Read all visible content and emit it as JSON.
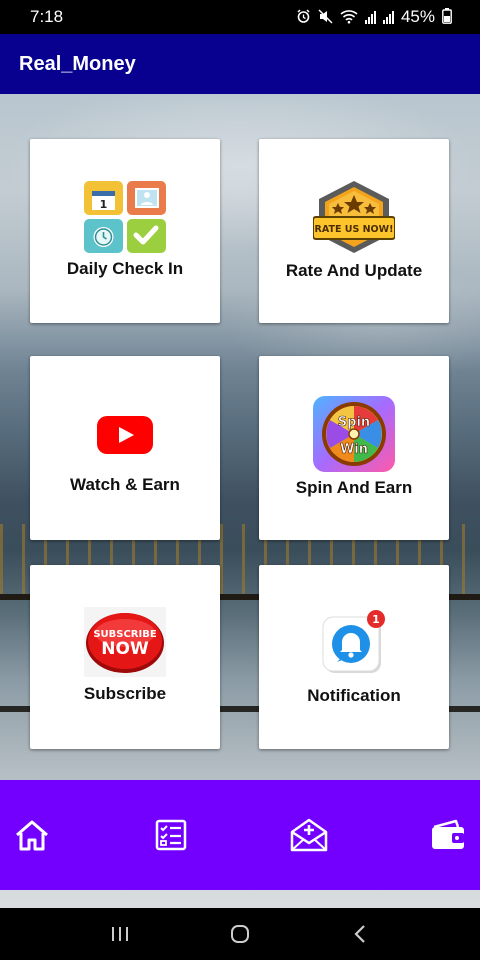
{
  "status_bar": {
    "time": "7:18",
    "battery": "45%"
  },
  "app_bar": {
    "title": "Real_Money"
  },
  "cards": [
    {
      "label": "Daily Check In",
      "icon": "calendar-check-icon"
    },
    {
      "label": "Rate And Update",
      "icon": "rate-us-badge-icon",
      "badge_text": "RATE US NOW!"
    },
    {
      "label": "Watch & Earn",
      "icon": "youtube-play-icon"
    },
    {
      "label": "Spin And Earn",
      "icon": "spin-wheel-icon",
      "wheel_text_top": "Spin",
      "wheel_text_bottom": "Win"
    },
    {
      "label": "Subscribe",
      "icon": "subscribe-now-icon",
      "badge_top": "SUBSCRIBE",
      "badge_bottom": "NOW"
    },
    {
      "label": "Notification",
      "icon": "notification-bell-icon",
      "count": "1"
    }
  ],
  "bottom_nav": [
    "home-icon",
    "task-list-icon",
    "invite-mail-icon",
    "wallet-icon"
  ],
  "colors": {
    "app_bar": "#08008f",
    "bottom_nav": "#7300ff",
    "card": "#ffffff"
  }
}
